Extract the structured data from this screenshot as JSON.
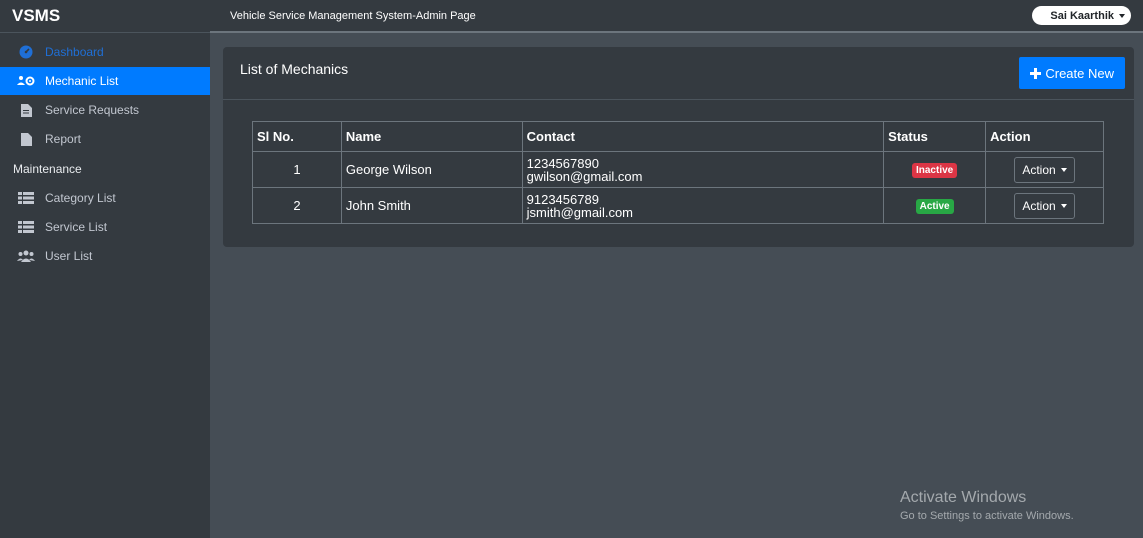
{
  "brand": "VSMS",
  "topbar": {
    "title": "Vehicle Service Management System-Admin Page",
    "user": "Sai Kaarthik"
  },
  "sidebar": {
    "items": [
      {
        "label": "Dashboard"
      },
      {
        "label": "Mechanic List"
      },
      {
        "label": "Service Requests"
      },
      {
        "label": "Report"
      }
    ],
    "header": "Maintenance",
    "maint_items": [
      {
        "label": "Category List"
      },
      {
        "label": "Service List"
      },
      {
        "label": "User List"
      }
    ]
  },
  "card": {
    "title": "List of Mechanics",
    "create_label": "Create New"
  },
  "table": {
    "headers": [
      "Sl No.",
      "Name",
      "Contact",
      "Status",
      "Action"
    ],
    "rows": [
      {
        "sl": "1",
        "name": "George Wilson",
        "phone": "1234567890",
        "email": "gwilson@gmail.com",
        "status": "Inactive",
        "action": "Action"
      },
      {
        "sl": "2",
        "name": "John Smith",
        "phone": "9123456789",
        "email": "jsmith@gmail.com",
        "status": "Active",
        "action": "Action"
      }
    ]
  },
  "colors": {
    "inactive": "#dc3545",
    "active": "#28a745",
    "primary": "#007bff"
  },
  "watermark": {
    "line1": "Activate Windows",
    "line2": "Go to Settings to activate Windows."
  }
}
